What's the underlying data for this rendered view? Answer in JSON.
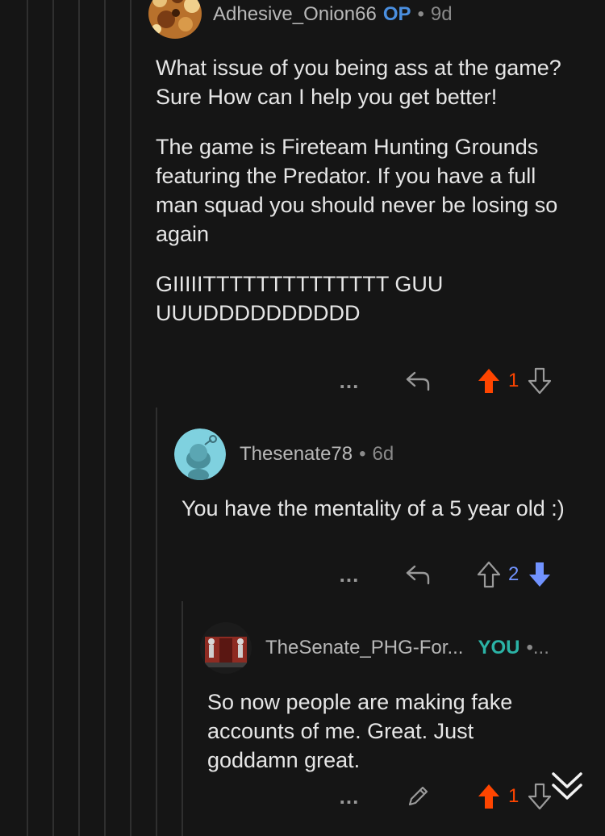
{
  "comments": [
    {
      "author": "Adhesive_Onion66",
      "badge": "OP",
      "separator": "•",
      "age": "9d",
      "paragraphs": [
        "What issue of you being ass at the game?  Sure How can I help you get better!",
        "The game is Fireteam Hunting Grounds featuring the Predator. If you have a full man squad you should never be losing so again",
        "GIIIIITTTTTTTTTTTTTT GUUUUUDDDDDDDDDD"
      ],
      "more_label": "...",
      "score": "1",
      "vote_state": "upvoted",
      "upvote_color": "#ff4500"
    },
    {
      "author": "Thesenate78",
      "separator": "•",
      "age": "6d",
      "paragraphs": [
        "You have the mentality of a 5 year old :)"
      ],
      "more_label": "...",
      "score": "2",
      "vote_state": "downvoted",
      "downvote_color": "#7193ff"
    },
    {
      "author": "TheSenate_PHG-For...",
      "badge": "YOU",
      "separator": "•...",
      "paragraphs": [
        "So now people are making fake accounts of me. Great. Just goddamn great."
      ],
      "more_label": "...",
      "score": "1",
      "vote_state": "upvoted",
      "upvote_color": "#ff4500"
    }
  ],
  "icons": {
    "reply": "reply-icon",
    "edit": "edit-pencil-icon",
    "upvote": "upvote-arrow-icon",
    "downvote": "downvote-arrow-icon",
    "scroll": "double-chevron-down-icon"
  }
}
